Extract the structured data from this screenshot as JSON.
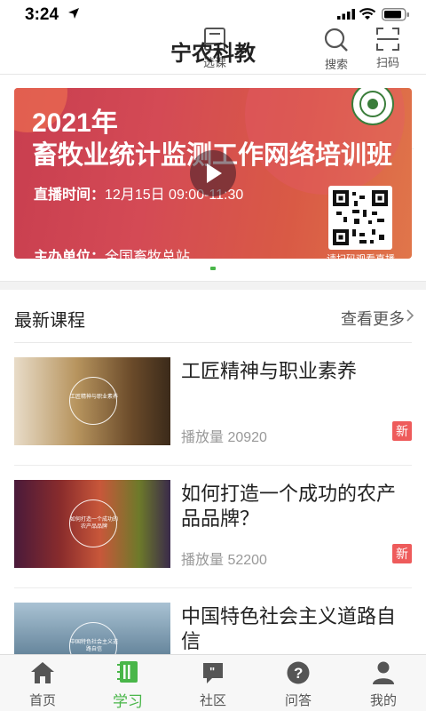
{
  "status": {
    "time": "3:24"
  },
  "header": {
    "title": "宁农科教",
    "course_select_label": "选课",
    "search_label": "搜索",
    "scan_label": "扫码"
  },
  "banner": {
    "year": "2021年",
    "title": "畜牧业统计监测工作网络培训班",
    "live_label": "直播时间：",
    "live_value": "12月15日 09:00-11:30",
    "org_label": "主办单位：",
    "org_value": "全国畜牧总站",
    "qr_caption": "请扫码观看直播"
  },
  "section": {
    "title": "最新课程",
    "more": "查看更多"
  },
  "courses": [
    {
      "title": "工匠精神与职业素养",
      "plays": "播放量 20920",
      "badge": "新",
      "thumb_text": "工匠精神与职业素养"
    },
    {
      "title": "如何打造一个成功的农产品品牌？",
      "plays": "播放量 52200",
      "badge": "新",
      "thumb_text": "如何打造一个成功的农产品品牌"
    },
    {
      "title": "中国特色社会主义道路自信",
      "thumb_text": "中国特色社会主义道路自信"
    }
  ],
  "tabs": [
    {
      "label": "首页"
    },
    {
      "label": "学习"
    },
    {
      "label": "社区"
    },
    {
      "label": "问答"
    },
    {
      "label": "我的"
    }
  ],
  "colors": {
    "accent": "#49b649",
    "badge": "#ee5b5b"
  }
}
